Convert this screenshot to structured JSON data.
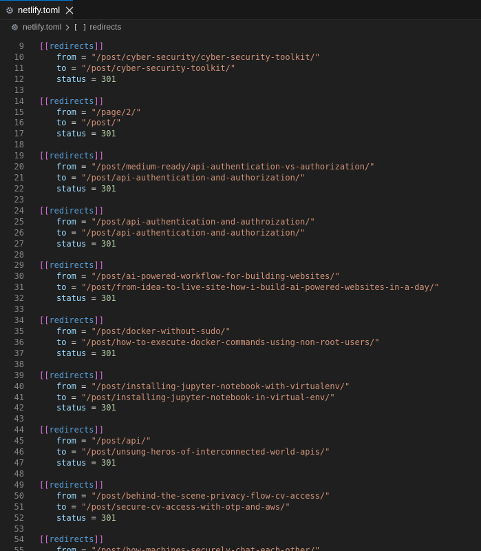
{
  "tab": {
    "label": "netlify.toml",
    "icon": "gear-icon",
    "close_icon": "close-icon",
    "accent": "#0078d4"
  },
  "breadcrumb": {
    "file": "netlify.toml",
    "symbol_icon": "[ ]",
    "symbol": "redirects"
  },
  "editor": {
    "keyword_table": "redirects",
    "lines": [
      {
        "n": "9",
        "kind": "header"
      },
      {
        "n": "10",
        "kind": "pair",
        "key": "from",
        "value": "\"/post/cyber-security/cyber-security-toolkit/\""
      },
      {
        "n": "11",
        "kind": "pair",
        "key": "to",
        "value": "\"/post/cyber-security-toolkit/\""
      },
      {
        "n": "12",
        "kind": "pair",
        "key": "status",
        "value": "301"
      },
      {
        "n": "13",
        "kind": "blank"
      },
      {
        "n": "14",
        "kind": "header"
      },
      {
        "n": "15",
        "kind": "pair",
        "key": "from",
        "value": "\"/page/2/\""
      },
      {
        "n": "16",
        "kind": "pair",
        "key": "to",
        "value": "\"/post/\""
      },
      {
        "n": "17",
        "kind": "pair",
        "key": "status",
        "value": "301"
      },
      {
        "n": "18",
        "kind": "blank"
      },
      {
        "n": "19",
        "kind": "header"
      },
      {
        "n": "20",
        "kind": "pair",
        "key": "from",
        "value": "\"/post/medium-ready/api-authentication-vs-authorization/\""
      },
      {
        "n": "21",
        "kind": "pair",
        "key": "to",
        "value": "\"/post/api-authentication-and-authorization/\""
      },
      {
        "n": "22",
        "kind": "pair",
        "key": "status",
        "value": "301"
      },
      {
        "n": "23",
        "kind": "blank"
      },
      {
        "n": "24",
        "kind": "header"
      },
      {
        "n": "25",
        "kind": "pair",
        "key": "from",
        "value": "\"/post/api-authentication-and-authroization/\""
      },
      {
        "n": "26",
        "kind": "pair",
        "key": "to",
        "value": "\"/post/api-authentication-and-authorization/\""
      },
      {
        "n": "27",
        "kind": "pair",
        "key": "status",
        "value": "301"
      },
      {
        "n": "28",
        "kind": "blank"
      },
      {
        "n": "29",
        "kind": "header"
      },
      {
        "n": "30",
        "kind": "pair",
        "key": "from",
        "value": "\"/post/ai-powered-workflow-for-building-websites/\""
      },
      {
        "n": "31",
        "kind": "pair",
        "key": "to",
        "value": "\"/post/from-idea-to-live-site-how-i-build-ai-powered-websites-in-a-day/\""
      },
      {
        "n": "32",
        "kind": "pair",
        "key": "status",
        "value": "301"
      },
      {
        "n": "33",
        "kind": "blank"
      },
      {
        "n": "34",
        "kind": "header"
      },
      {
        "n": "35",
        "kind": "pair",
        "key": "from",
        "value": "\"/post/docker-without-sudo/\""
      },
      {
        "n": "36",
        "kind": "pair",
        "key": "to",
        "value": "\"/post/how-to-execute-docker-commands-using-non-root-users/\""
      },
      {
        "n": "37",
        "kind": "pair",
        "key": "status",
        "value": "301"
      },
      {
        "n": "38",
        "kind": "blank"
      },
      {
        "n": "39",
        "kind": "header"
      },
      {
        "n": "40",
        "kind": "pair",
        "key": "from",
        "value": "\"/post/installing-jupyter-notebook-with-virtualenv/\""
      },
      {
        "n": "41",
        "kind": "pair",
        "key": "to",
        "value": "\"/post/installing-jupyter-notebook-in-virtual-env/\""
      },
      {
        "n": "42",
        "kind": "pair",
        "key": "status",
        "value": "301"
      },
      {
        "n": "43",
        "kind": "blank"
      },
      {
        "n": "44",
        "kind": "header"
      },
      {
        "n": "45",
        "kind": "pair",
        "key": "from",
        "value": "\"/post/api/\""
      },
      {
        "n": "46",
        "kind": "pair",
        "key": "to",
        "value": "\"/post/unsung-heros-of-interconnected-world-apis/\""
      },
      {
        "n": "47",
        "kind": "pair",
        "key": "status",
        "value": "301"
      },
      {
        "n": "48",
        "kind": "blank"
      },
      {
        "n": "49",
        "kind": "header"
      },
      {
        "n": "50",
        "kind": "pair",
        "key": "from",
        "value": "\"/post/behind-the-scene-privacy-flow-cv-access/\""
      },
      {
        "n": "51",
        "kind": "pair",
        "key": "to",
        "value": "\"/post/secure-cv-access-with-otp-and-aws/\""
      },
      {
        "n": "52",
        "kind": "pair",
        "key": "status",
        "value": "301"
      },
      {
        "n": "53",
        "kind": "blank"
      },
      {
        "n": "54",
        "kind": "header"
      },
      {
        "n": "55",
        "kind": "pair",
        "key": "from",
        "value": "\"/post/how-machines-securely-chat-each-other/\""
      }
    ]
  }
}
